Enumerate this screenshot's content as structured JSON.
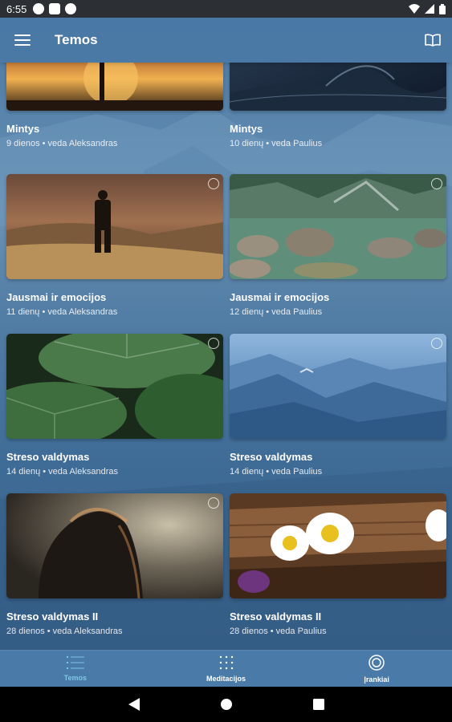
{
  "status_bar": {
    "time": "6:55",
    "icons": [
      "app-notification-icon",
      "app-notification-icon",
      "app-notification-icon",
      "wifi-icon",
      "signal-icon",
      "battery-icon"
    ]
  },
  "app_bar": {
    "title": "Temos",
    "menu_icon": "hamburger-menu-icon",
    "action_icon": "open-book-icon"
  },
  "cards": [
    {
      "title": "Mintys",
      "meta": "9 dienos • veda Aleksandras",
      "image": "sunset-silhouette",
      "has_radio": false
    },
    {
      "title": "Mintys",
      "meta": "10 dienų • veda Paulius",
      "image": "ocean-wave",
      "has_radio": false
    },
    {
      "title": "Jausmai ir emocijos",
      "meta": "11 dienų • veda Aleksandras",
      "image": "man-in-field",
      "has_radio": true
    },
    {
      "title": "Jausmai ir emocijos",
      "meta": "12 dienų • veda Paulius",
      "image": "mountain-lake-rocks",
      "has_radio": true
    },
    {
      "title": "Streso valdymas",
      "meta": "14 dienų • veda Aleksandras",
      "image": "large-green-leaves",
      "has_radio": true
    },
    {
      "title": "Streso valdymas",
      "meta": "14 dienų • veda Paulius",
      "image": "blue-mountains-bird",
      "has_radio": true
    },
    {
      "title": "Streso valdymas II",
      "meta": "28 dienos • veda Aleksandras",
      "image": "woman-backlit",
      "has_radio": true
    },
    {
      "title": "Streso valdymas II",
      "meta": "28 dienos • veda Paulius",
      "image": "daisies-on-wood",
      "has_radio": false
    }
  ],
  "bottom_nav": [
    {
      "label": "Temos",
      "icon": "list-icon",
      "active": true
    },
    {
      "label": "Meditacijos",
      "icon": "dots-grid-icon",
      "active": false
    },
    {
      "label": "Įrankiai",
      "icon": "target-circle-icon",
      "active": false
    }
  ],
  "colors": {
    "app_bar": "#4a78a6",
    "active_nav": "#7fc6e6",
    "background": "#3f6c97"
  }
}
